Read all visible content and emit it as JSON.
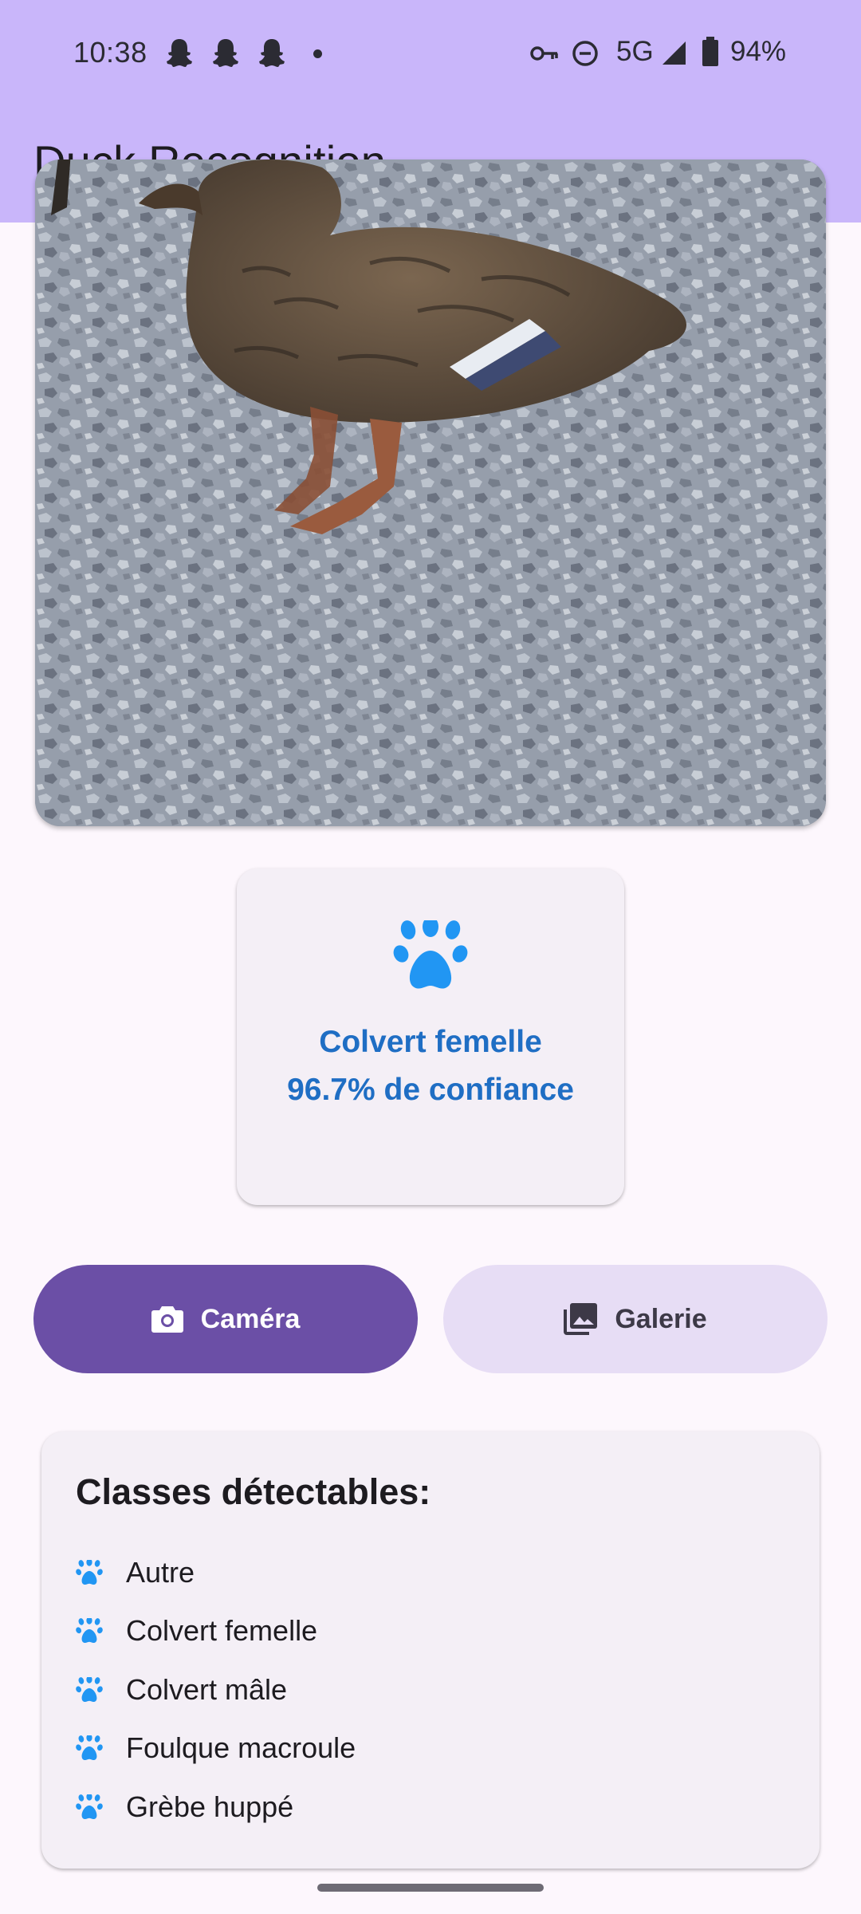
{
  "status_bar": {
    "time": "10:38",
    "network": "5G",
    "battery": "94%",
    "icons": [
      "snapchat-icon",
      "snapchat-icon",
      "snapchat-icon",
      "dot-icon",
      "vpn-key-icon",
      "do-not-disturb-icon",
      "signal-icon",
      "battery-icon"
    ]
  },
  "app_bar": {
    "title": "Duck Recognition",
    "background": "#c9b6fa"
  },
  "image": {
    "subject": "female mallard duck on gravel"
  },
  "result": {
    "icon": "paw-icon",
    "label": "Colvert femelle",
    "confidence_text": "96.7% de confiance",
    "confidence_value": 96.7,
    "color": "#1f6ec4"
  },
  "buttons": {
    "camera": {
      "label": "Caméra",
      "icon": "camera-icon",
      "background": "#6b4fa6"
    },
    "gallery": {
      "label": "Galerie",
      "icon": "photo-library-icon",
      "background": "#e7ddf5"
    }
  },
  "classes": {
    "title": "Classes détectables:",
    "items": [
      {
        "label": "Autre",
        "icon": "paw-icon"
      },
      {
        "label": "Colvert femelle",
        "icon": "paw-icon"
      },
      {
        "label": "Colvert mâle",
        "icon": "paw-icon"
      },
      {
        "label": "Foulque macroule",
        "icon": "paw-icon"
      },
      {
        "label": "Grèbe huppé",
        "icon": "paw-icon"
      }
    ]
  }
}
